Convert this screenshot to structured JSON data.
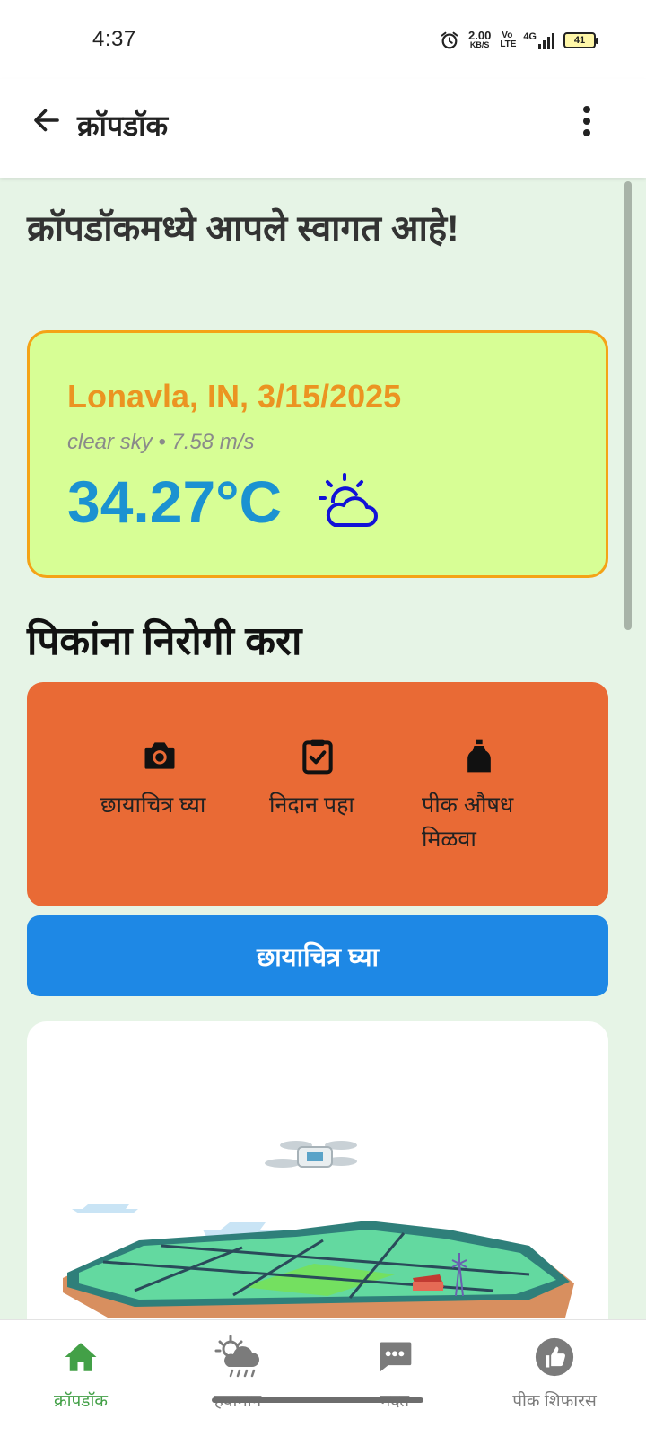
{
  "status_bar": {
    "time": "4:37",
    "net_speed_value": "2.00",
    "net_speed_unit": "KB/S",
    "volte": "Vo LTE",
    "network": "4G",
    "battery": "41"
  },
  "app_bar": {
    "title": "क्रॉपडॉक",
    "back_icon": "arrow-left-icon",
    "menu_icon": "more-vert-icon"
  },
  "welcome_text": "क्रॉपडॉकमध्ये आपले स्वागत आहे!",
  "weather": {
    "location_date": "Lonavla, IN, 3/15/2025",
    "description": "clear sky • 7.58 m/s",
    "temperature": "34.27°C",
    "icon": "partly-cloudy-icon",
    "card_bg": "#d7fe95",
    "card_border": "#f4a316",
    "location_color": "#eb9421",
    "temp_color": "#1b92d1"
  },
  "section_title": "पिकांना निरोगी करा",
  "steps": {
    "bg_color": "#e96a35",
    "items": [
      {
        "label": "छायाचित्र घ्या",
        "icon": "camera-icon"
      },
      {
        "label": "निदान पहा",
        "icon": "clipboard-check-icon"
      },
      {
        "label": "पीक औषध मिळवा",
        "icon": "medicine-bottle-icon"
      }
    ]
  },
  "primary_button": {
    "label": "छायाचित्र घ्या",
    "color": "#1e88e5"
  },
  "illustration": {
    "description_icon": "farm-drone-illustration"
  },
  "bottom_nav": {
    "active_color": "#43a047",
    "items": [
      {
        "label": "क्रॉपडॉक",
        "icon": "home-icon"
      },
      {
        "label": "हवामान",
        "icon": "weather-icon"
      },
      {
        "label": "मदत",
        "icon": "chat-icon"
      },
      {
        "label": "पीक शिफारस",
        "icon": "thumbs-up-icon"
      }
    ]
  }
}
